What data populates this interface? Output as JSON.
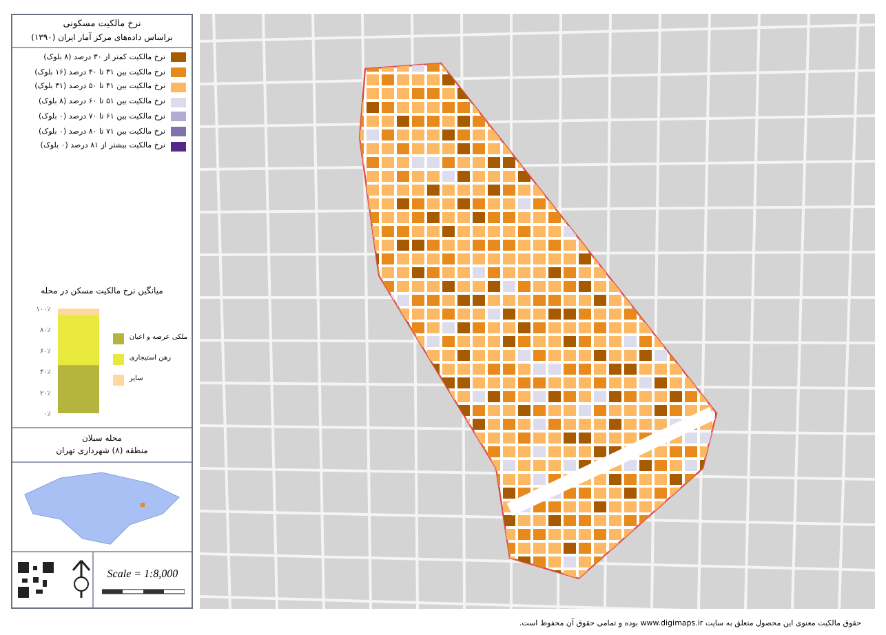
{
  "legend": {
    "title": "نرخ مالکیت مسکونی",
    "subtitle": "براساس داده‌های مرکز آمار ایران (۱۳۹۰)",
    "items": [
      {
        "label": "نرخ مالکیت کمتر از ۳۰ درصد (۸ بلوک)",
        "color": "#a85a00"
      },
      {
        "label": "نرخ مالکیت بین ۳۱ تا ۴۰ درصد (۱۶ بلوک)",
        "color": "#e8891c"
      },
      {
        "label": "نرخ مالکیت بین ۴۱ تا ۵۰ درصد (۳۱ بلوک)",
        "color": "#fdb863"
      },
      {
        "label": "نرخ مالکیت بین ۵۱ تا ۶۰ درصد (۸ بلوک)",
        "color": "#dcdcec"
      },
      {
        "label": "نرخ مالکیت بین ۶۱ تا ۷۰ درصد (۰ بلوک)",
        "color": "#b2abd2"
      },
      {
        "label": "نرخ مالکیت بین ۷۱ تا ۸۰ درصد (۰ بلوک)",
        "color": "#8073ac"
      },
      {
        "label": "نرخ مالکیت بیشتر از ۸۱ درصد (۰ بلوک)",
        "color": "#542788"
      }
    ]
  },
  "chart": {
    "chart_data": {
      "type": "bar",
      "title": "میانگین نرخ مالکیت مسکن در محله",
      "stacked": true,
      "ylim": [
        0,
        100
      ],
      "yticks": [
        {
          "value": 0,
          "label": "۰٪"
        },
        {
          "value": 20,
          "label": "۲۰٪"
        },
        {
          "value": 40,
          "label": "۴۰٪"
        },
        {
          "value": 60,
          "label": "۶۰٪"
        },
        {
          "value": 80,
          "label": "۸۰٪"
        },
        {
          "value": 100,
          "label": "۱۰۰٪"
        }
      ],
      "series": [
        {
          "name": "ملکی عرصه و اعیان",
          "color": "#b5b43c",
          "values": [
            46
          ]
        },
        {
          "name": "رهن استیجاری",
          "color": "#e9e83c",
          "values": [
            48
          ]
        },
        {
          "name": "سایر",
          "color": "#fdd9a0",
          "values": [
            6
          ]
        }
      ]
    }
  },
  "neighborhood": {
    "name": "محله سبلان",
    "district": "منطقه (۸) شهرداری تهران"
  },
  "scale": {
    "text": "Scale = 1:8,000"
  },
  "copyright": "حقوق مالکیت معنوی این محصول متعلق به سایت www.digimaps.ir بوده و تمامی حقوق آن محفوظ است."
}
